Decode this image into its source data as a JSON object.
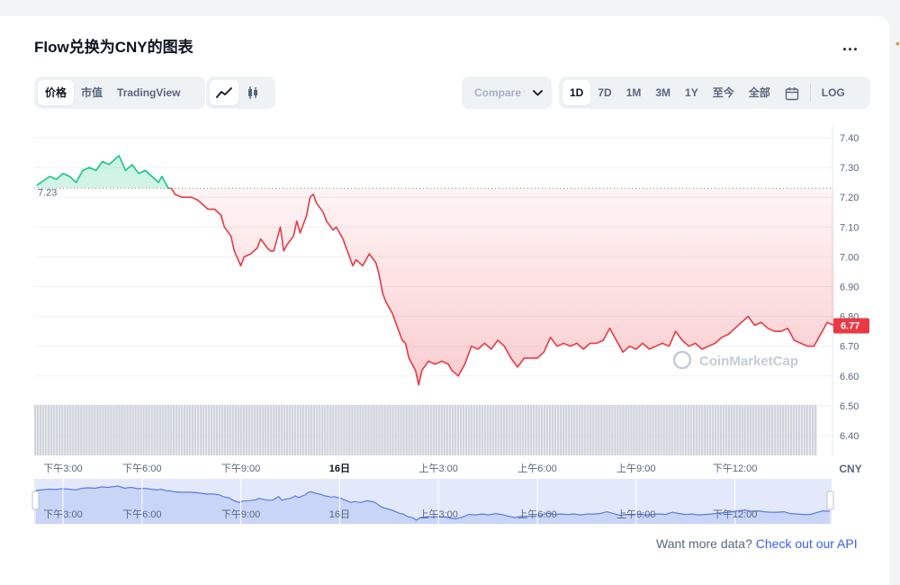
{
  "header": {
    "title": "Flow兑换为CNY的图表",
    "more_label": "..."
  },
  "toolbar": {
    "data_tabs": [
      {
        "label": "价格",
        "active": true
      },
      {
        "label": "市值",
        "active": false
      },
      {
        "label": "TradingView",
        "active": false
      }
    ],
    "chart_types": [
      {
        "icon": "line-chart-icon",
        "active": true
      },
      {
        "icon": "candlestick-icon",
        "active": false
      }
    ],
    "compare_label": "Compare with",
    "ranges": [
      {
        "label": "1D",
        "active": true
      },
      {
        "label": "7D",
        "active": false
      },
      {
        "label": "1M",
        "active": false
      },
      {
        "label": "3M",
        "active": false
      },
      {
        "label": "1Y",
        "active": false
      },
      {
        "label": "至今",
        "active": false
      },
      {
        "label": "全部",
        "active": false
      }
    ],
    "log_label": "LOG"
  },
  "colors": {
    "up": "#16c784",
    "down": "#ea3943",
    "accent": "#3861fb",
    "navigator": "#5a7be0"
  },
  "chart_data": {
    "type": "line",
    "currency_label": "CNY",
    "watermark": "CoinMarketCap",
    "open_price_label": "7.23",
    "current_price_label": "6.77",
    "yticks": [
      "7.40",
      "7.30",
      "7.20",
      "7.10",
      "7.00",
      "6.90",
      "6.80",
      "6.70",
      "6.60",
      "6.50",
      "6.40"
    ],
    "xticks": [
      "下午3:00",
      "下午6:00",
      "下午9:00",
      "16日",
      "上午3:00",
      "上午6:00",
      "上午9:00",
      "下午12:00"
    ],
    "baseline": 7.23,
    "ylim": [
      6.4,
      7.4
    ],
    "x_range_hours": [
      0,
      24
    ],
    "x_tick_hours": [
      0,
      3,
      6,
      9,
      12,
      15,
      18,
      21
    ],
    "points": [
      [
        -0.2,
        7.24
      ],
      [
        0.2,
        7.27
      ],
      [
        0.4,
        7.26
      ],
      [
        0.6,
        7.28
      ],
      [
        0.8,
        7.27
      ],
      [
        1.0,
        7.25
      ],
      [
        1.2,
        7.29
      ],
      [
        1.4,
        7.3
      ],
      [
        1.6,
        7.29
      ],
      [
        1.8,
        7.32
      ],
      [
        2.0,
        7.31
      ],
      [
        2.2,
        7.33
      ],
      [
        2.3,
        7.34
      ],
      [
        2.5,
        7.29
      ],
      [
        2.7,
        7.31
      ],
      [
        2.9,
        7.28
      ],
      [
        3.1,
        7.29
      ],
      [
        3.3,
        7.27
      ],
      [
        3.5,
        7.25
      ],
      [
        3.6,
        7.27
      ],
      [
        3.8,
        7.23
      ],
      [
        3.9,
        7.23
      ],
      [
        4.0,
        7.21
      ],
      [
        4.2,
        7.2
      ],
      [
        4.5,
        7.2
      ],
      [
        4.7,
        7.19
      ],
      [
        4.9,
        7.17
      ],
      [
        5.0,
        7.16
      ],
      [
        5.2,
        7.16
      ],
      [
        5.4,
        7.14
      ],
      [
        5.5,
        7.1
      ],
      [
        5.7,
        7.07
      ],
      [
        5.8,
        7.02
      ],
      [
        6.0,
        6.97
      ],
      [
        6.1,
        7.0
      ],
      [
        6.3,
        7.01
      ],
      [
        6.5,
        7.03
      ],
      [
        6.6,
        7.06
      ],
      [
        6.8,
        7.03
      ],
      [
        6.9,
        7.02
      ],
      [
        7.0,
        7.02
      ],
      [
        7.2,
        7.1
      ],
      [
        7.3,
        7.02
      ],
      [
        7.4,
        7.04
      ],
      [
        7.6,
        7.07
      ],
      [
        7.7,
        7.12
      ],
      [
        7.8,
        7.08
      ],
      [
        8.0,
        7.14
      ],
      [
        8.1,
        7.2
      ],
      [
        8.2,
        7.21
      ],
      [
        8.3,
        7.18
      ],
      [
        8.5,
        7.15
      ],
      [
        8.6,
        7.12
      ],
      [
        8.8,
        7.09
      ],
      [
        8.9,
        7.1
      ],
      [
        9.1,
        7.06
      ],
      [
        9.2,
        7.03
      ],
      [
        9.4,
        6.97
      ],
      [
        9.5,
        6.99
      ],
      [
        9.7,
        6.97
      ],
      [
        9.9,
        7.01
      ],
      [
        10.1,
        6.98
      ],
      [
        10.2,
        6.94
      ],
      [
        10.3,
        6.88
      ],
      [
        10.4,
        6.85
      ],
      [
        10.6,
        6.81
      ],
      [
        10.7,
        6.78
      ],
      [
        10.9,
        6.72
      ],
      [
        11.0,
        6.71
      ],
      [
        11.1,
        6.66
      ],
      [
        11.3,
        6.62
      ],
      [
        11.4,
        6.57
      ],
      [
        11.5,
        6.62
      ],
      [
        11.7,
        6.65
      ],
      [
        11.9,
        6.64
      ],
      [
        12.1,
        6.65
      ],
      [
        12.3,
        6.64
      ],
      [
        12.4,
        6.62
      ],
      [
        12.6,
        6.6
      ],
      [
        12.8,
        6.64
      ],
      [
        13.0,
        6.7
      ],
      [
        13.2,
        6.69
      ],
      [
        13.4,
        6.71
      ],
      [
        13.6,
        6.69
      ],
      [
        13.8,
        6.72
      ],
      [
        14.0,
        6.7
      ],
      [
        14.2,
        6.66
      ],
      [
        14.4,
        6.63
      ],
      [
        14.6,
        6.66
      ],
      [
        14.8,
        6.66
      ],
      [
        15.0,
        6.66
      ],
      [
        15.2,
        6.68
      ],
      [
        15.4,
        6.73
      ],
      [
        15.6,
        6.7
      ],
      [
        15.8,
        6.71
      ],
      [
        16.0,
        6.7
      ],
      [
        16.2,
        6.71
      ],
      [
        16.4,
        6.69
      ],
      [
        16.6,
        6.71
      ],
      [
        16.8,
        6.71
      ],
      [
        17.0,
        6.72
      ],
      [
        17.2,
        6.76
      ],
      [
        17.4,
        6.72
      ],
      [
        17.6,
        6.68
      ],
      [
        17.8,
        6.7
      ],
      [
        18.0,
        6.69
      ],
      [
        18.2,
        6.71
      ],
      [
        18.4,
        6.69
      ],
      [
        18.6,
        6.7
      ],
      [
        18.8,
        6.71
      ],
      [
        19.0,
        6.7
      ],
      [
        19.2,
        6.75
      ],
      [
        19.4,
        6.72
      ],
      [
        19.6,
        6.7
      ],
      [
        19.8,
        6.71
      ],
      [
        20.0,
        6.69
      ],
      [
        20.2,
        6.7
      ],
      [
        20.4,
        6.71
      ],
      [
        20.6,
        6.73
      ],
      [
        20.8,
        6.74
      ],
      [
        21.0,
        6.76
      ],
      [
        21.2,
        6.78
      ],
      [
        21.4,
        6.8
      ],
      [
        21.6,
        6.77
      ],
      [
        21.8,
        6.78
      ],
      [
        22.0,
        6.76
      ],
      [
        22.2,
        6.75
      ],
      [
        22.4,
        6.75
      ],
      [
        22.6,
        6.76
      ],
      [
        22.8,
        6.72
      ],
      [
        23.0,
        6.71
      ],
      [
        23.2,
        6.7
      ],
      [
        23.4,
        6.7
      ],
      [
        23.6,
        6.74
      ],
      [
        23.8,
        6.78
      ],
      [
        24.0,
        6.77
      ]
    ],
    "volume": [
      1.0,
      1.0,
      1.0,
      1.0,
      1.0,
      1.0,
      1.0,
      1.0,
      1.0,
      1.0,
      1.0,
      1.0,
      1.0,
      1.0,
      1.0,
      1.0,
      1.0,
      1.0,
      1.0,
      1.0,
      1.0,
      1.0,
      1.0,
      1.0,
      1.0,
      1.0,
      1.0,
      1.0,
      1.0,
      1.0,
      1.0,
      1.0,
      1.0,
      1.0,
      1.0,
      1.0,
      1.0,
      1.0,
      1.0,
      1.0,
      1.0,
      1.0,
      1.0,
      1.0,
      1.0,
      1.0,
      1.0,
      1.0,
      1.0,
      1.0,
      1.0,
      1.0,
      1.0,
      1.0,
      1.0,
      1.0,
      1.0,
      1.0,
      1.0,
      1.0,
      1.0,
      1.0,
      1.0,
      1.0,
      1.0,
      1.0,
      1.0,
      1.0,
      1.0,
      1.0,
      1.0,
      1.0,
      1.0,
      1.0,
      1.0,
      1.0,
      1.0,
      1.0,
      1.0,
      1.0,
      1.0,
      1.0,
      1.0,
      1.0,
      1.0,
      1.0,
      1.0,
      1.0,
      1.0,
      1.0,
      1.0,
      1.0,
      1.0,
      1.0,
      1.0,
      1.0,
      1.0,
      1.0,
      1.0,
      1.0,
      1.0,
      1.0,
      1.0,
      1.0,
      1.0,
      1.0,
      1.0,
      1.0,
      1.0,
      1.0,
      1.0,
      1.0,
      1.0,
      1.0,
      1.0,
      1.0,
      1.0,
      1.0,
      1.0,
      1.0,
      1.0,
      1.0,
      1.0,
      1.0,
      1.0,
      1.0,
      1.0,
      1.0,
      1.0,
      1.0,
      1.0,
      1.0,
      1.0,
      1.0,
      1.0,
      1.0,
      1.0,
      1.0,
      1.0,
      1.0,
      1.0,
      1.0,
      1.0,
      1.0,
      1.0,
      1.0,
      1.0,
      1.0,
      1.0,
      1.0,
      1.0,
      1.0,
      1.0,
      1.0,
      1.0,
      1.0,
      1.0,
      1.0,
      1.0,
      1.0,
      1.0,
      1.0,
      1.0,
      1.0,
      1.0,
      1.0,
      1.0,
      1.0,
      1.0,
      1.0,
      1.0,
      1.0,
      1.0,
      1.0,
      1.0,
      1.0,
      1.0,
      1.0,
      1.0,
      1.0,
      1.0,
      1.0,
      1.0,
      1.0,
      1.0,
      1.0,
      1.0,
      1.0,
      1.0,
      1.0,
      1.0,
      1.0,
      1.0,
      1.0,
      1.0,
      1.0,
      1.0,
      1.0,
      1.0,
      1.0,
      1.0,
      1.0,
      1.0,
      1.0,
      1.0,
      1.0,
      1.0,
      1.0,
      1.0,
      1.0,
      1.0,
      1.0,
      1.0,
      1.0,
      1.0,
      1.0,
      1.0,
      1.0,
      1.0,
      1.0,
      1.0,
      1.0,
      1.0,
      1.0,
      1.0,
      1.0,
      1.0,
      1.0,
      1.0,
      1.0,
      1.0,
      1.0,
      1.0,
      1.0,
      1.0,
      1.0,
      1.0,
      1.0,
      1.0,
      1.0,
      1.0,
      1.0,
      1.0,
      1.0,
      1.0,
      1.0,
      1.0,
      1.0,
      1.0,
      1.0,
      1.0,
      1.0,
      1.0,
      1.0,
      1.0,
      1.0,
      1.0,
      1.0,
      1.0,
      1.0,
      1.0,
      1.0,
      1.0,
      1.0,
      1.0,
      1.0,
      1.0,
      1.0,
      1.0,
      1.0,
      1.0,
      1.0,
      1.0,
      1.0,
      1.0,
      1.0,
      1.0,
      1.0,
      1.0,
      1.0,
      1.0,
      1.0,
      1.0,
      1.0,
      1.0,
      1.0,
      1.0,
      1.0,
      1.0
    ]
  },
  "footer": {
    "text": "Want more data?",
    "link": "Check out our API"
  }
}
